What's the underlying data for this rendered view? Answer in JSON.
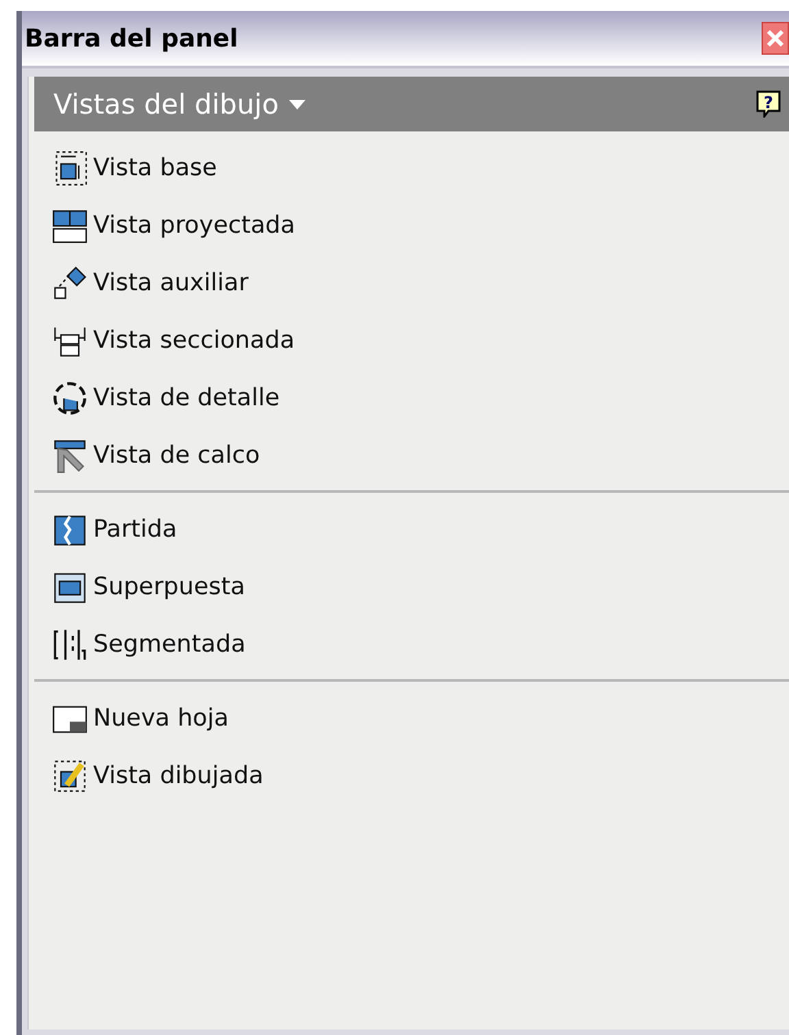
{
  "window": {
    "title": "Barra del panel"
  },
  "panel": {
    "title": "Vistas del dibujo",
    "help": "?"
  },
  "groups": [
    {
      "items": [
        {
          "label": "Vista base"
        },
        {
          "label": "Vista proyectada"
        },
        {
          "label": "Vista auxiliar"
        },
        {
          "label": "Vista seccionada"
        },
        {
          "label": "Vista de detalle"
        },
        {
          "label": "Vista de calco"
        }
      ]
    },
    {
      "items": [
        {
          "label": "Partida"
        },
        {
          "label": "Superpuesta"
        },
        {
          "label": "Segmentada"
        }
      ]
    },
    {
      "items": [
        {
          "label": "Nueva hoja"
        },
        {
          "label": "Vista dibujada"
        }
      ]
    }
  ]
}
